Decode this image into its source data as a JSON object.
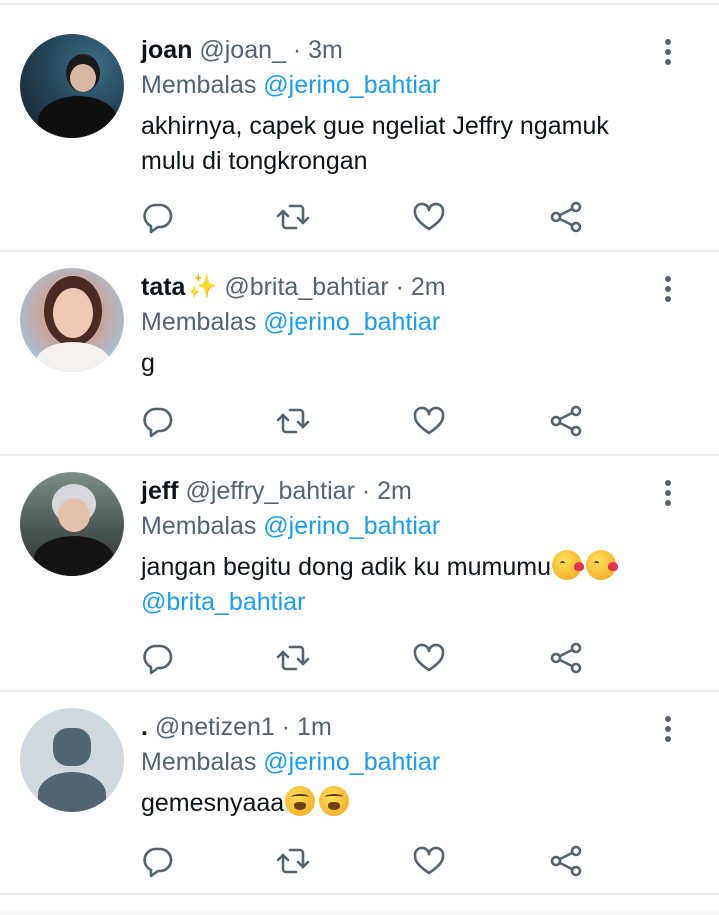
{
  "tweets": [
    {
      "name": "joan",
      "handle": "@joan_",
      "dot": "·",
      "time": "3m",
      "reply_prefix": "Membalas",
      "reply_to": "@jerino_bahtiar",
      "text": "akhirnya, capek gue ngeliat Jeffry ngamuk mulu di tongkrongan",
      "avatar": "user-photo"
    },
    {
      "name": "tata",
      "name_decoration": "sparkles-icon",
      "handle": "@brita_bahtiar",
      "dot": "·",
      "time": "2m",
      "reply_prefix": "Membalas",
      "reply_to": "@jerino_bahtiar",
      "text": "g",
      "avatar": "user-photo"
    },
    {
      "name": "jeff",
      "handle": "@jeffry_bahtiar",
      "dot": "·",
      "time": "2m",
      "reply_prefix": "Membalas",
      "reply_to": "@jerino_bahtiar",
      "text": "jangan begitu dong adik ku mumumu",
      "text_emojis": [
        "face-blowing-kiss-emoji",
        "face-blowing-kiss-emoji"
      ],
      "text_mention": "@brita_bahtiar",
      "avatar": "user-photo"
    },
    {
      "name": ".",
      "handle": "@netizen1",
      "dot": "·",
      "time": "1m",
      "reply_prefix": "Membalas",
      "reply_to": "@jerino_bahtiar",
      "text": "gemesnyaaa",
      "text_emojis": [
        "weary-face-emoji",
        "weary-face-emoji"
      ],
      "avatar": "default-avatar"
    }
  ],
  "actions": [
    "reply-icon",
    "retweet-icon",
    "like-icon",
    "share-icon"
  ],
  "colors": {
    "mention": "#1d9bf0",
    "secondary_text": "#536471",
    "primary_text": "#0f1419",
    "divider": "#e6ecf0"
  }
}
